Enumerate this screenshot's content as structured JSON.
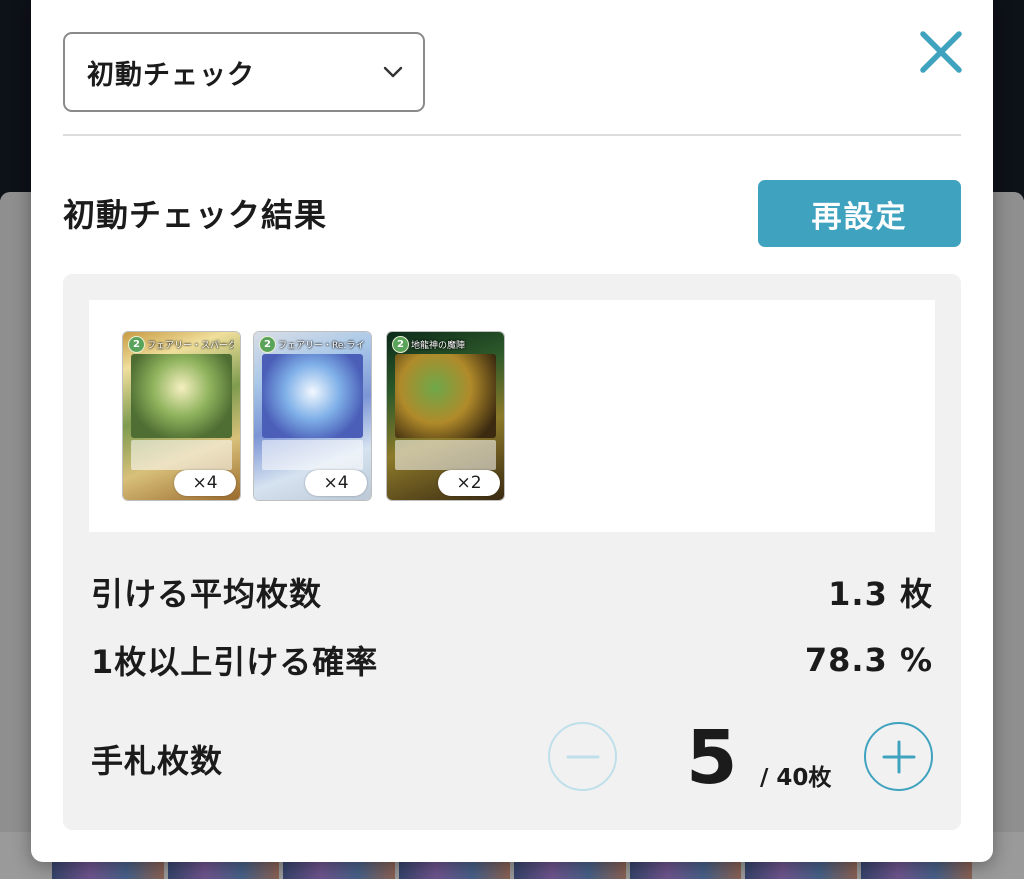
{
  "dropdown": {
    "value": "初動チェック"
  },
  "result": {
    "title": "初動チェック結果",
    "reset_label": "再設定"
  },
  "cards": [
    {
      "cost": "2",
      "name": "フェアリー・スパーク",
      "count": "×4"
    },
    {
      "cost": "2",
      "name": "フェアリー・Re:ライフ",
      "count": "×4"
    },
    {
      "cost": "2",
      "name": "地龍神の魔陣",
      "count": "×2"
    }
  ],
  "stats": {
    "avg_label": "引ける平均枚数",
    "avg_value": "1.3 枚",
    "prob_label": "1枚以上引ける確率",
    "prob_value": "78.3 %"
  },
  "hand": {
    "label": "手札枚数",
    "value": "5",
    "total": "/ 40枚"
  },
  "colors": {
    "accent": "#3fa3bf",
    "accent_light": "#bfe0ea",
    "panel": "#f1f1f1"
  },
  "icons": {
    "close": "close-icon",
    "dropdown": "chevron-down-icon",
    "minus": "minus-icon",
    "plus": "plus-icon"
  }
}
